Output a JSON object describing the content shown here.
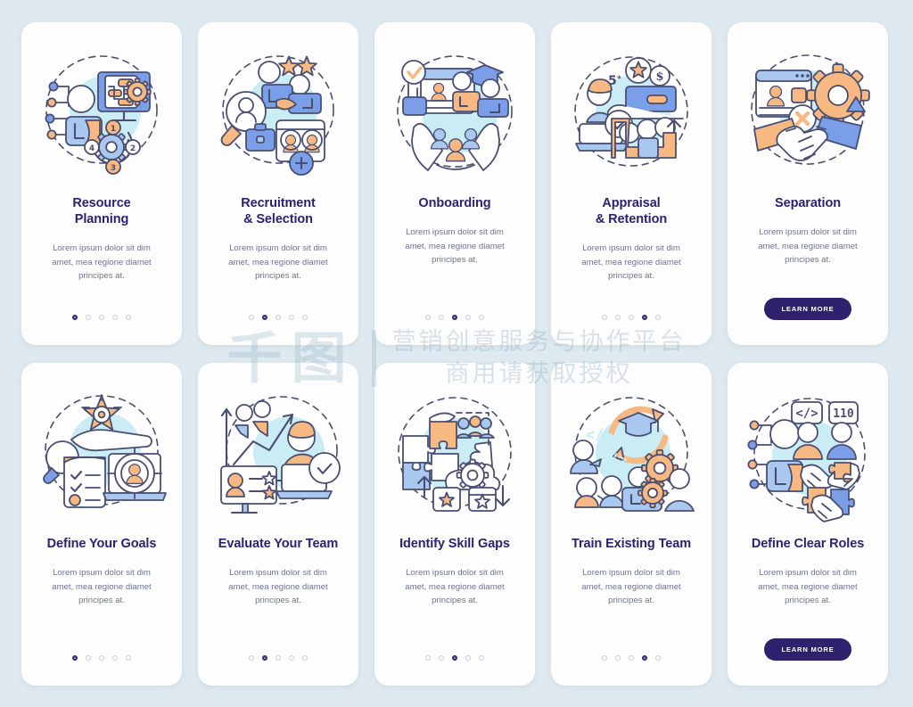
{
  "palette": {
    "page_background": "#dfeaf0",
    "card_background": "#fdfdfd",
    "title_color": "#2e2073",
    "body_color": "#6f7490",
    "button_background": "#30216e",
    "button_text": "#ffffff",
    "accent_blue": "#7a9fe8",
    "accent_light_blue": "#a8c8f0",
    "accent_orange": "#f7b981",
    "accent_cyan": "#c9ecf5",
    "outline": "#4a4f72",
    "dot_inactive": "#c9ccdb"
  },
  "watermark": {
    "logo": "千图",
    "line1": "营销创意服务与协作平台",
    "line2": "商用请获取授权"
  },
  "common": {
    "body_text": "Lorem ipsum dolor sit dim\namet, mea regione diamet\nprincipes at.",
    "learn_more_label": "LEARN MORE",
    "dot_count": 5
  },
  "cards": [
    {
      "id": "resource-planning",
      "title": "Resource\nPlanning",
      "body": "Lorem ipsum dolor sit dim\namet, mea regione diamet\nprincipes at.",
      "footer_type": "dots",
      "active_dot": 1,
      "illustration": "resource-planning-illustration"
    },
    {
      "id": "recruitment-selection",
      "title": "Recruitment\n& Selection",
      "body": "Lorem ipsum dolor sit dim\namet, mea regione diamet\nprincipes at.",
      "footer_type": "dots",
      "active_dot": 2,
      "illustration": "recruitment-selection-illustration"
    },
    {
      "id": "onboarding",
      "title": "Onboarding",
      "body": "Lorem ipsum dolor sit dim\namet, mea regione diamet\nprincipes at.",
      "footer_type": "dots",
      "active_dot": 3,
      "illustration": "onboarding-illustration"
    },
    {
      "id": "appraisal-retention",
      "title": "Appraisal\n& Retention",
      "body": "Lorem ipsum dolor sit dim\namet, mea regione diamet\nprincipes at.",
      "footer_type": "dots",
      "active_dot": 4,
      "illustration": "appraisal-retention-illustration"
    },
    {
      "id": "separation",
      "title": "Separation",
      "body": "Lorem ipsum dolor sit dim\namet, mea regione diamet\nprincipes at.",
      "footer_type": "button",
      "button_label": "LEARN MORE",
      "illustration": "separation-illustration"
    },
    {
      "id": "define-your-goals",
      "title": "Define Your Goals",
      "body": "Lorem ipsum dolor sit dim\namet, mea regione diamet\nprincipes at.",
      "footer_type": "dots",
      "active_dot": 1,
      "illustration": "define-your-goals-illustration"
    },
    {
      "id": "evaluate-your-team",
      "title": "Evaluate Your Team",
      "body": "Lorem ipsum dolor sit dim\namet, mea regione diamet\nprincipes at.",
      "footer_type": "dots",
      "active_dot": 2,
      "illustration": "evaluate-your-team-illustration"
    },
    {
      "id": "identify-skill-gaps",
      "title": "Identify Skill Gaps",
      "body": "Lorem ipsum dolor sit dim\namet, mea regione diamet\nprincipes at.",
      "footer_type": "dots",
      "active_dot": 3,
      "illustration": "identify-skill-gaps-illustration"
    },
    {
      "id": "train-existing-team",
      "title": "Train Existing Team",
      "body": "Lorem ipsum dolor sit dim\namet, mea regione diamet\nprincipes at.",
      "footer_type": "dots",
      "active_dot": 4,
      "illustration": "train-existing-team-illustration"
    },
    {
      "id": "define-clear-roles",
      "title": "Define Clear Roles",
      "body": "Lorem ipsum dolor sit dim\namet, mea regione diamet\nprincipes at.",
      "footer_type": "button",
      "button_label": "LEARN MORE",
      "illustration": "define-clear-roles-illustration"
    }
  ]
}
